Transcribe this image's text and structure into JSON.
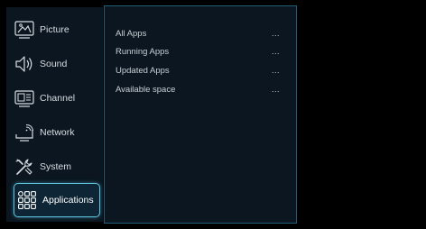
{
  "sidebar": {
    "items": [
      {
        "label": "Picture",
        "icon": "picture-icon"
      },
      {
        "label": "Sound",
        "icon": "sound-icon"
      },
      {
        "label": "Channel",
        "icon": "channel-icon"
      },
      {
        "label": "Network",
        "icon": "network-icon"
      },
      {
        "label": "System",
        "icon": "system-icon"
      },
      {
        "label": "Applications",
        "icon": "applications-icon",
        "selected": true
      }
    ]
  },
  "applications_panel": {
    "rows": [
      {
        "label": "All Apps",
        "value": "..."
      },
      {
        "label": "Running Apps",
        "value": "..."
      },
      {
        "label": "Updated Apps",
        "value": "..."
      },
      {
        "label": "Available space",
        "value": "..."
      }
    ]
  },
  "colors": {
    "background": "#000000",
    "panel": "#0b1620",
    "accent": "#5ec4e0",
    "panel_border": "#1f5d79"
  }
}
